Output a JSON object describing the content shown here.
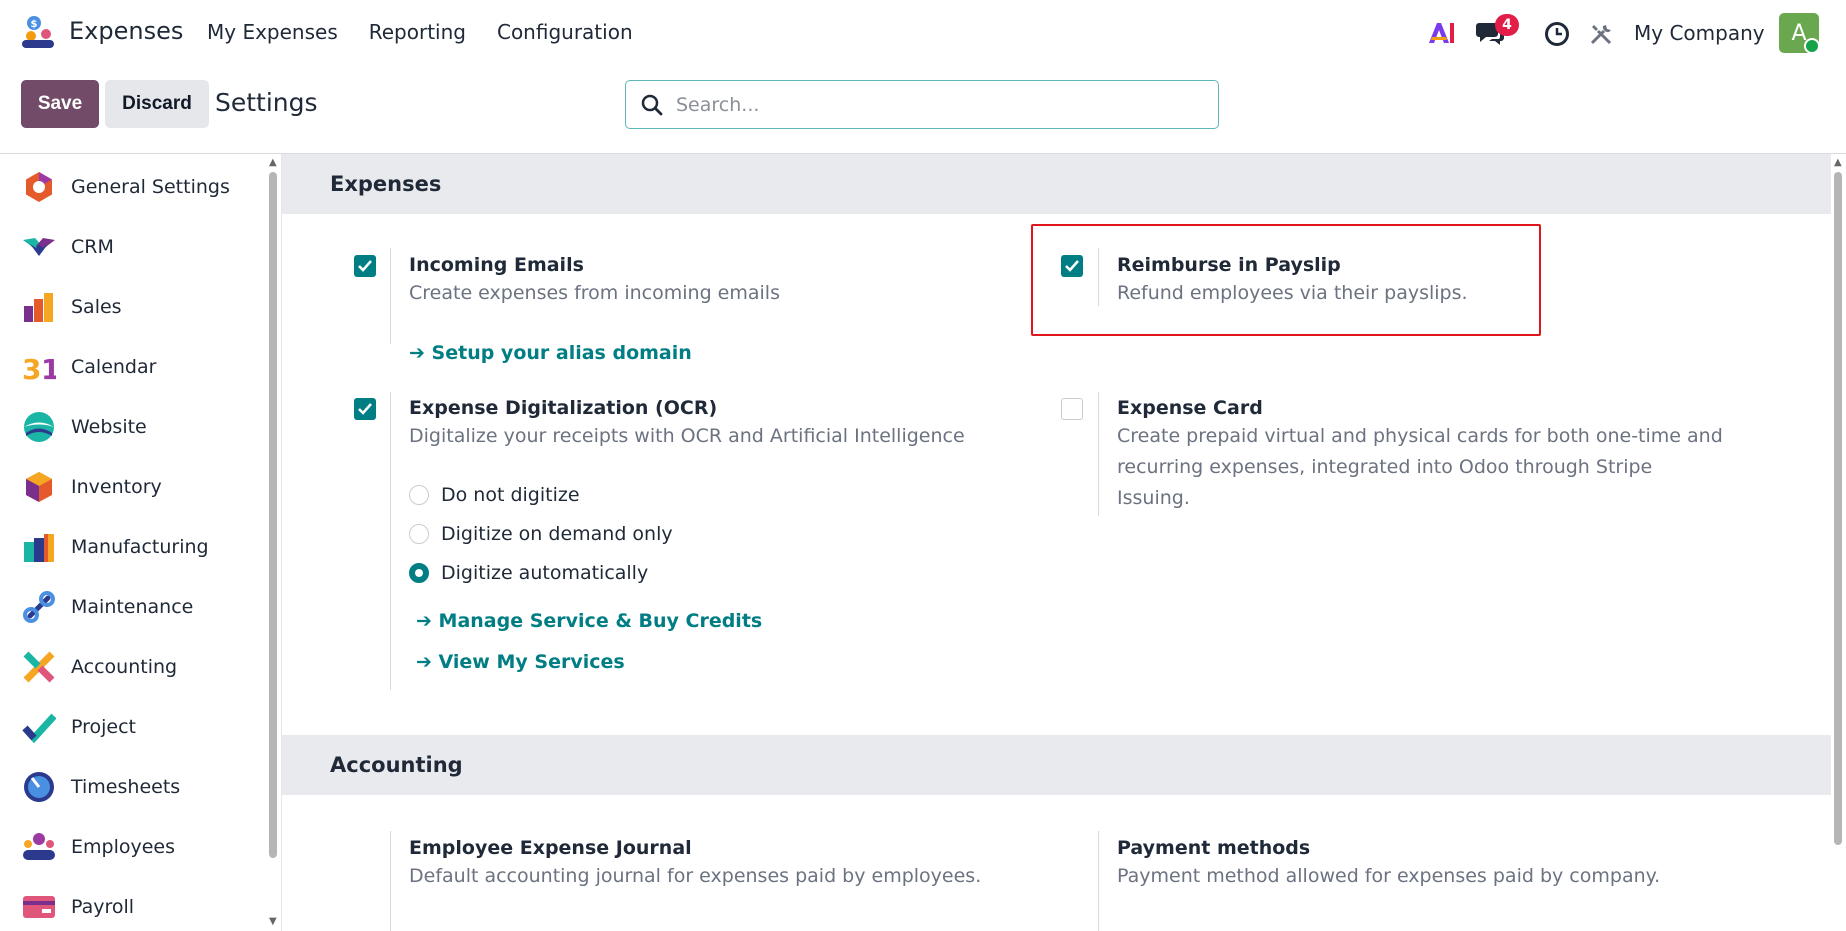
{
  "navbar": {
    "app_name": "Expenses",
    "menu": [
      "My Expenses",
      "Reporting",
      "Configuration"
    ],
    "notification_count": "4",
    "company": "My Company",
    "avatar_letter": "A"
  },
  "control": {
    "save_label": "Save",
    "discard_label": "Discard",
    "title": "Settings",
    "search_placeholder": "Search..."
  },
  "sidebar": {
    "items": [
      {
        "label": "General Settings",
        "icon": "general-settings-icon"
      },
      {
        "label": "CRM",
        "icon": "crm-icon"
      },
      {
        "label": "Sales",
        "icon": "sales-icon"
      },
      {
        "label": "Calendar",
        "icon": "calendar-icon"
      },
      {
        "label": "Website",
        "icon": "website-icon"
      },
      {
        "label": "Inventory",
        "icon": "inventory-icon"
      },
      {
        "label": "Manufacturing",
        "icon": "manufacturing-icon"
      },
      {
        "label": "Maintenance",
        "icon": "maintenance-icon"
      },
      {
        "label": "Accounting",
        "icon": "accounting-icon"
      },
      {
        "label": "Project",
        "icon": "project-icon"
      },
      {
        "label": "Timesheets",
        "icon": "timesheets-icon"
      },
      {
        "label": "Employees",
        "icon": "employees-icon"
      },
      {
        "label": "Payroll",
        "icon": "payroll-icon"
      }
    ]
  },
  "sections": {
    "expenses": {
      "title": "Expenses",
      "incoming_emails": {
        "title": "Incoming Emails",
        "desc": "Create expenses from incoming emails",
        "link": "➔ Setup your alias domain",
        "checked": true
      },
      "reimburse": {
        "title": "Reimburse in Payslip",
        "desc": "Refund employees via their payslips.",
        "checked": true
      },
      "ocr": {
        "title": "Expense Digitalization (OCR)",
        "desc": "Digitalize your receipts with OCR and Artificial Intelligence",
        "options": [
          "Do not digitize",
          "Digitize on demand only",
          "Digitize automatically"
        ],
        "selected": "Digitize automatically",
        "link1": "➔ Manage Service & Buy Credits",
        "link2": "➔ View My Services",
        "checked": true
      },
      "card": {
        "title": "Expense Card",
        "desc": "Create prepaid virtual and physical cards for both one-time and recurring expenses, integrated into Odoo through Stripe Issuing.",
        "checked": false
      }
    },
    "accounting": {
      "title": "Accounting",
      "journal": {
        "title": "Employee Expense Journal",
        "desc": "Default accounting journal for expenses paid by employees."
      },
      "payment": {
        "title": "Payment methods",
        "desc": "Payment method allowed for expenses paid by company."
      }
    }
  },
  "colors": {
    "brand": "#714b67",
    "accent": "#017e84",
    "highlight": "#e0161c",
    "badge": "#e11d48"
  }
}
